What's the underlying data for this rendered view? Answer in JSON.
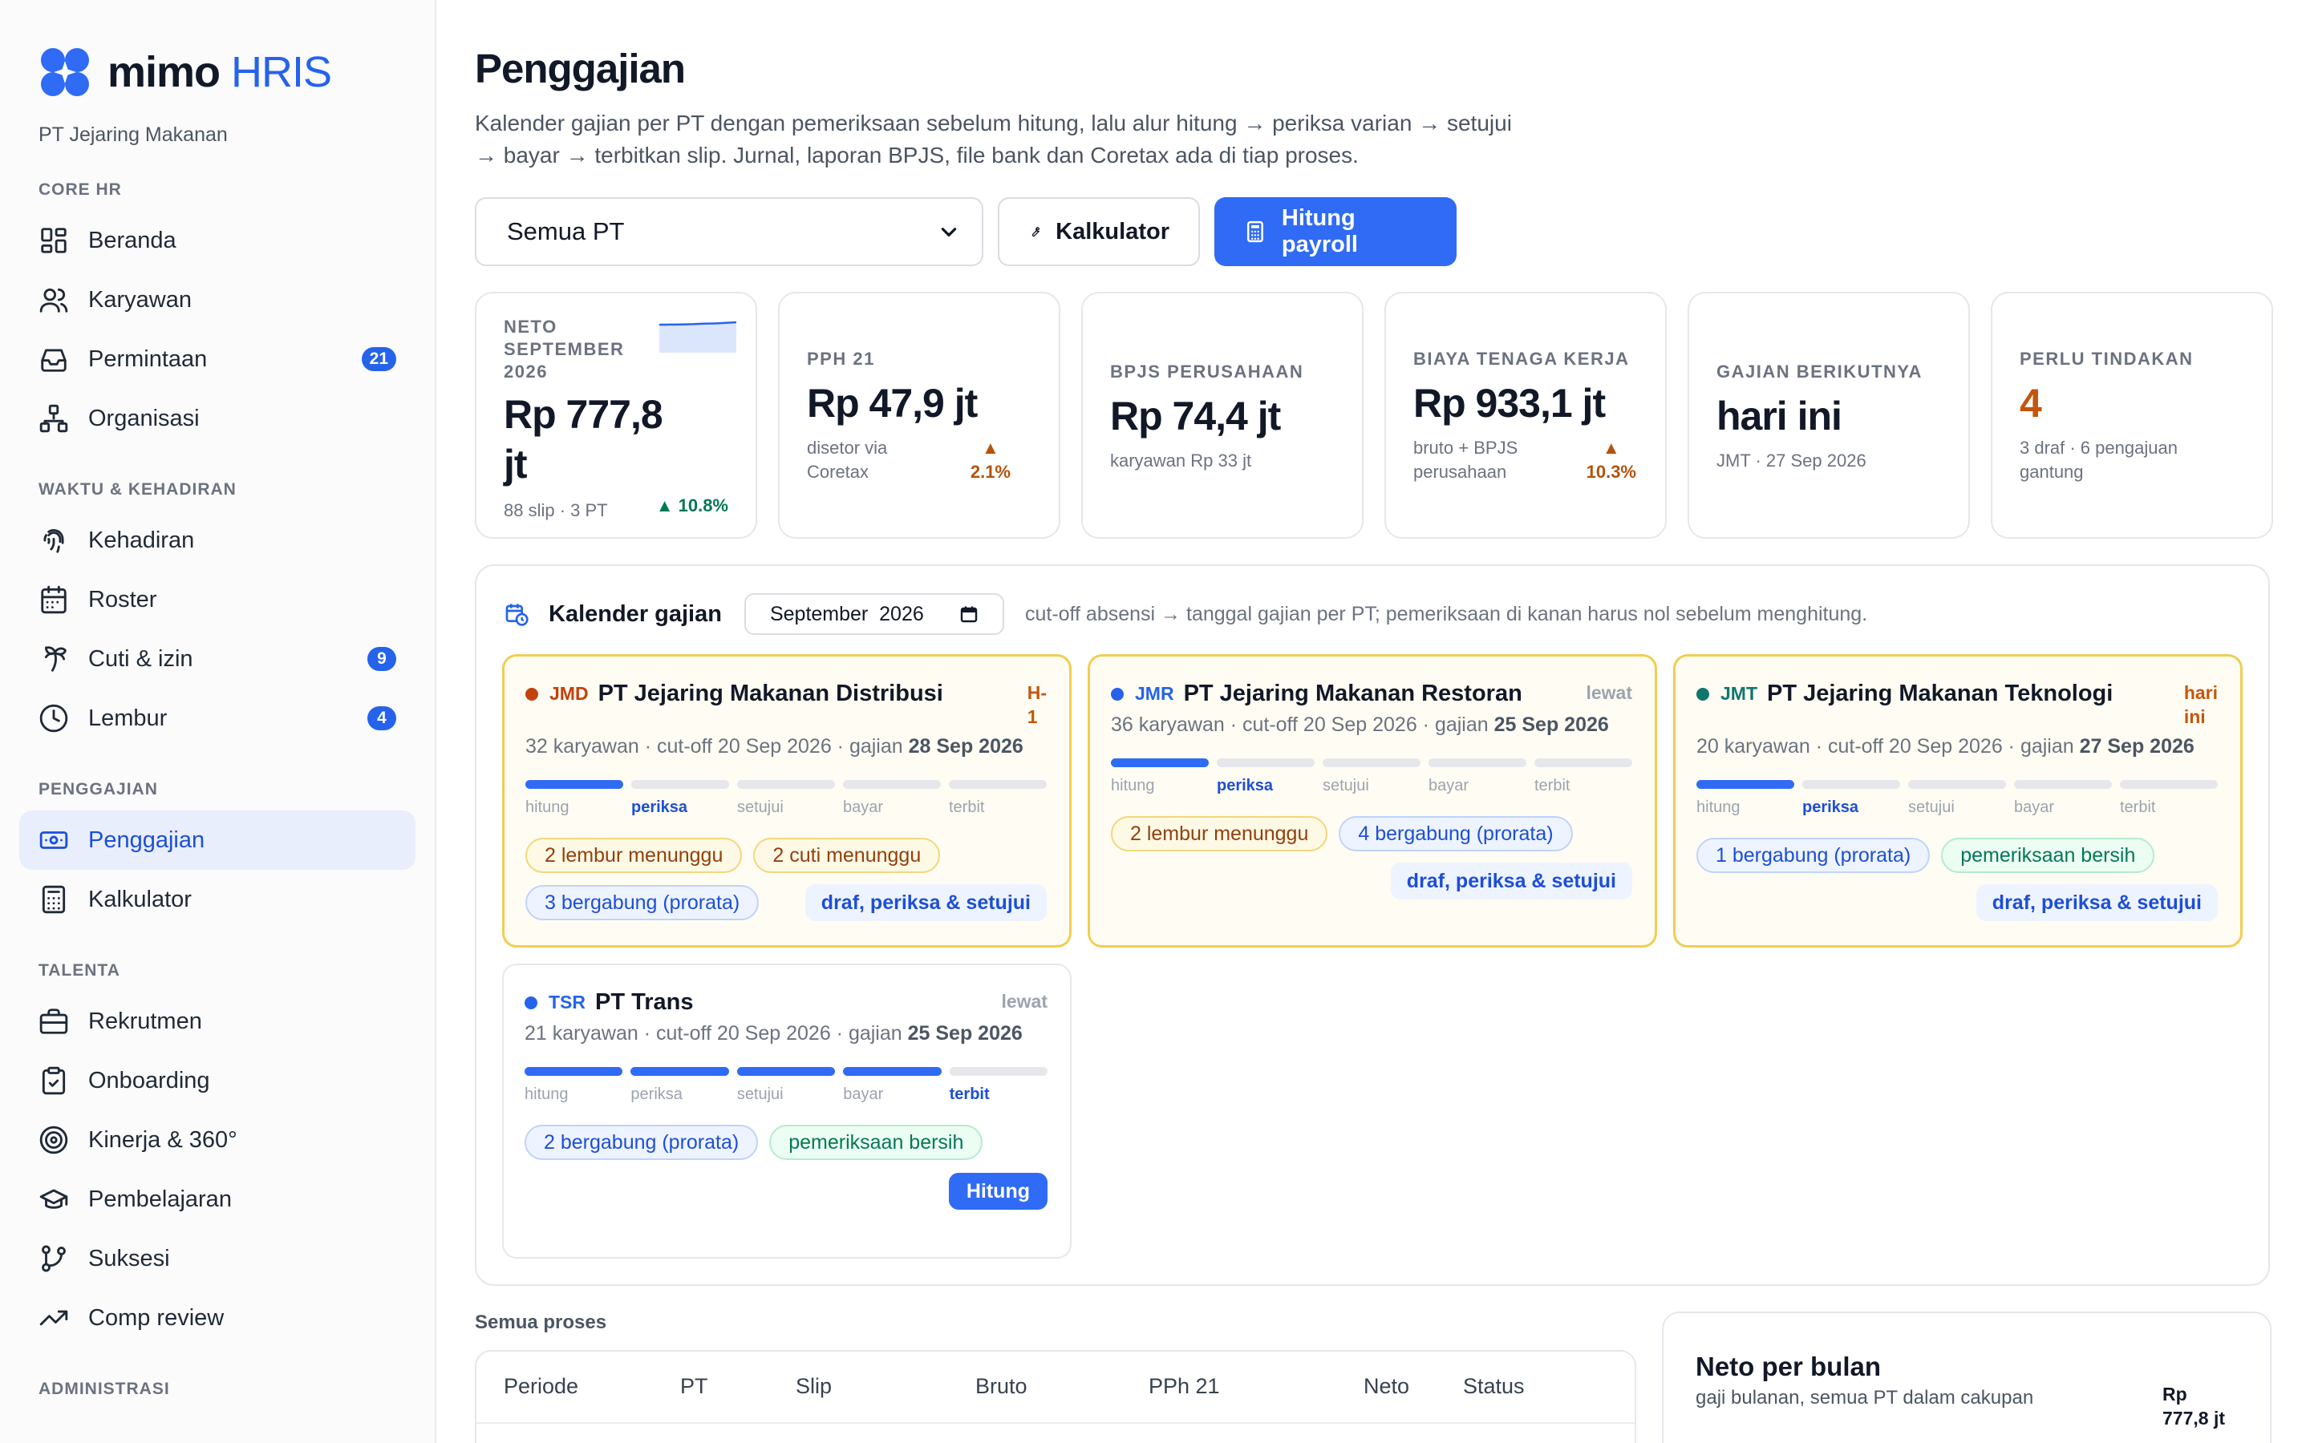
{
  "brand": {
    "name_main": "mimo",
    "name_accent": "HRIS",
    "company": "PT Jejaring Makanan"
  },
  "sidebar": {
    "sections": [
      {
        "title": "CORE HR",
        "items": [
          {
            "label": "Beranda",
            "icon": "dashboard-icon"
          },
          {
            "label": "Karyawan",
            "icon": "users-icon"
          },
          {
            "label": "Permintaan",
            "icon": "inbox-icon",
            "badge": "21"
          },
          {
            "label": "Organisasi",
            "icon": "org-chart-icon"
          }
        ]
      },
      {
        "title": "WAKTU & KEHADIRAN",
        "items": [
          {
            "label": "Kehadiran",
            "icon": "fingerprint-icon"
          },
          {
            "label": "Roster",
            "icon": "calendar-icon"
          },
          {
            "label": "Cuti & izin",
            "icon": "palm-tree-icon",
            "badge": "9"
          },
          {
            "label": "Lembur",
            "icon": "clock-icon",
            "badge": "4"
          }
        ]
      },
      {
        "title": "PENGGAJIAN",
        "items": [
          {
            "label": "Penggajian",
            "icon": "banknote-icon",
            "active": true
          },
          {
            "label": "Kalkulator",
            "icon": "calculator-icon"
          }
        ]
      },
      {
        "title": "TALENTA",
        "items": [
          {
            "label": "Rekrutmen",
            "icon": "briefcase-icon"
          },
          {
            "label": "Onboarding",
            "icon": "clipboard-check-icon"
          },
          {
            "label": "Kinerja & 360°",
            "icon": "target-icon"
          },
          {
            "label": "Pembelajaran",
            "icon": "graduation-cap-icon"
          },
          {
            "label": "Suksesi",
            "icon": "git-branch-icon"
          },
          {
            "label": "Comp review",
            "icon": "trending-up-icon"
          }
        ]
      },
      {
        "title": "ADMINISTRASI",
        "items": []
      }
    ]
  },
  "header": {
    "title": "Penggajian",
    "description": "Kalender gajian per PT dengan pemeriksaan sebelum hitung, lalu alur hitung → periksa varian → setujui → bayar → terbitkan slip. Jurnal, laporan BPJS, file bank dan Coretax ada di tiap proses."
  },
  "toolbar": {
    "company_select": "Semua PT",
    "calculator_label": "Kalkulator",
    "run_payroll_label": "Hitung payroll"
  },
  "kpis": [
    {
      "label": "NETO SEPTEMBER 2026",
      "value": "Rp 777,8 jt",
      "sub": "88 slip · 3 PT",
      "delta": "▲ 10.8%",
      "delta_tone": "good",
      "sparkline": [
        0.62,
        0.64,
        0.66,
        0.7,
        0.78,
        0.82,
        0.9,
        1.0
      ]
    },
    {
      "label": "PPH 21",
      "value": "Rp 47,9 jt",
      "sub": "disetor via Coretax",
      "delta_arrow": "▲",
      "delta_value": "2.1%",
      "delta_tone": "bad"
    },
    {
      "label": "BPJS PERUSAHAAN",
      "value": "Rp 74,4 jt",
      "sub": "karyawan Rp 33 jt"
    },
    {
      "label": "BIAYA TENAGA KERJA",
      "value": "Rp 933,1 jt",
      "sub": "bruto + BPJS perusahaan",
      "delta_arrow": "▲",
      "delta_value": "10.3%",
      "delta_tone": "bad"
    },
    {
      "label": "GAJIAN BERIKUTNYA",
      "value": "hari ini",
      "sub": "JMT · 27 Sep 2026"
    },
    {
      "label": "PERLU TINDAKAN",
      "value": "4",
      "sub": "3 draf · 6 pengajuan gantung"
    }
  ],
  "calendar": {
    "title": "Kalender gajian",
    "month": "September  2026",
    "note": "cut-off absensi → tanggal gajian per PT; pemeriksaan di kanan harus nol sebelum menghitung.",
    "step_labels": [
      "hitung",
      "periksa",
      "setujui",
      "bayar",
      "terbit"
    ],
    "cards": [
      {
        "code": "JMD",
        "name": "PT Jejaring Makanan Distribusi",
        "dot": "#c2410c",
        "code_color": "#c2410c",
        "tag_l1": "H-",
        "tag_l2": "1",
        "tag_tone": "orange",
        "meta_pre": "32 karyawan · cut-off 20 Sep 2026 · gajian ",
        "meta_bold": "28 Sep 2026",
        "done": 1,
        "current": 1,
        "pills": [
          {
            "text": "2 lembur menunggu",
            "tone": "yellow"
          },
          {
            "text": "2 cuti menunggu",
            "tone": "yellow"
          },
          {
            "text": "3 bergabung (prorata)",
            "tone": "blue"
          }
        ],
        "action": "draf, periksa & setujui"
      },
      {
        "code": "JMR",
        "name": "PT Jejaring Makanan Restoran",
        "dot": "#2563eb",
        "code_color": "#2563eb",
        "tag_l1": "lewat",
        "tag_l2": "",
        "tag_tone": "gray",
        "meta_pre": "36 karyawan · cut-off 20 Sep 2026 · gajian ",
        "meta_bold": "25 Sep 2026",
        "done": 1,
        "current": 1,
        "pills": [
          {
            "text": "2 lembur menunggu",
            "tone": "yellow"
          },
          {
            "text": "4 bergabung (prorata)",
            "tone": "blue"
          }
        ],
        "action": "draf, periksa & setujui"
      },
      {
        "code": "JMT",
        "name": "PT Jejaring Makanan Teknologi",
        "dot": "#0f766e",
        "code_color": "#0f766e",
        "tag_l1": "hari",
        "tag_l2": "ini",
        "tag_tone": "orange",
        "meta_pre": "20 karyawan · cut-off 20 Sep 2026 · gajian ",
        "meta_bold": "27 Sep 2026",
        "done": 1,
        "current": 1,
        "pills": [
          {
            "text": "1 bergabung (prorata)",
            "tone": "blue"
          },
          {
            "text": "pemeriksaan bersih",
            "tone": "green"
          }
        ],
        "action": "draf, periksa & setujui"
      },
      {
        "code": "TSR",
        "name": "PT Trans",
        "dot": "#2563eb",
        "code_color": "#2563eb",
        "tag_l1": "lewat",
        "tag_l2": "",
        "tag_tone": "gray",
        "meta_pre": "21 karyawan · cut-off 20 Sep 2026 · gajian ",
        "meta_bold": "25 Sep 2026",
        "done": 4,
        "current": 4,
        "pills": [
          {
            "text": "2 bergabung (prorata)",
            "tone": "blue"
          },
          {
            "text": "pemeriksaan bersih",
            "tone": "green"
          }
        ],
        "button": "Hitung"
      }
    ]
  },
  "processes": {
    "label": "Semua proses",
    "columns": [
      "Periode",
      "PT",
      "Slip",
      "Bruto",
      "PPh 21",
      "Neto",
      "Status"
    ]
  },
  "neto_card": {
    "title": "Neto per bulan",
    "subtitle": "gaji bulanan, semua PT dalam cakupan",
    "value": "Rp 777,8 jt"
  }
}
